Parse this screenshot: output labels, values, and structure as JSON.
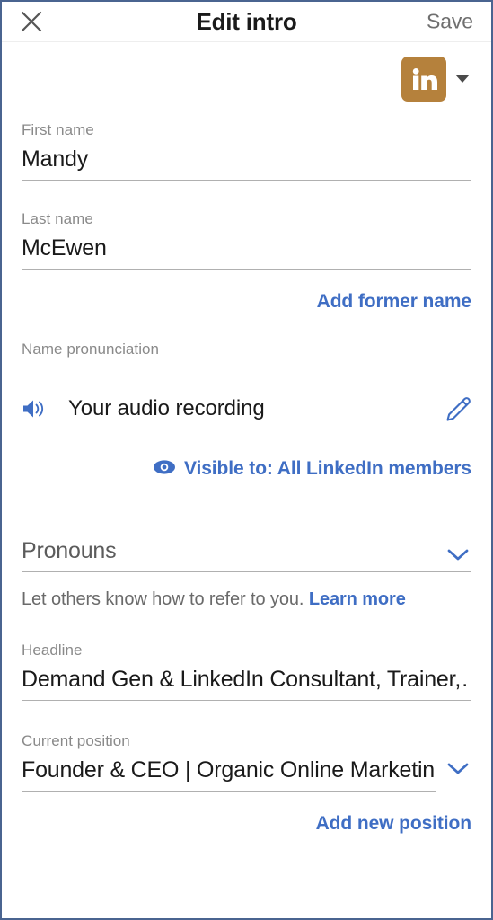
{
  "header": {
    "close_icon": "close-icon",
    "title": "Edit intro",
    "save_label": "Save"
  },
  "branding": {
    "logo_icon": "linkedin-logo-icon",
    "logo_text": "in",
    "logo_color": "#b5813c",
    "dropdown_icon": "caret-down-icon"
  },
  "fields": {
    "first_name": {
      "label": "First name",
      "value": "Mandy",
      "placeholder": "First name"
    },
    "last_name": {
      "label": "Last name",
      "value": "McEwen",
      "placeholder": "Last name"
    },
    "add_former_name": "Add former name",
    "name_pronunciation": {
      "label": "Name pronunciation",
      "audio_icon": "speaker-icon",
      "audio_label": "Your audio recording",
      "edit_icon": "pencil-icon",
      "visibility_icon": "eye-icon",
      "visibility_label": "Visible to: All LinkedIn members"
    },
    "pronouns": {
      "label": "Pronouns",
      "chevron_icon": "chevron-down-icon",
      "helper_text": "Let others know how to refer to you.",
      "helper_link": "Learn more"
    },
    "headline": {
      "label": "Headline",
      "value": "Demand Gen & LinkedIn Consultant, Trainer,…"
    },
    "current_position": {
      "label": "Current position",
      "value": "Founder & CEO | Organic Online Marketing…",
      "chevron_icon": "chevron-down-icon"
    },
    "add_new_position": "Add new position"
  },
  "colors": {
    "link_blue": "#3f6ec4",
    "icon_blue": "#3f6ec4",
    "label_gray": "#8a8a8a",
    "text_dark": "#1a1a1a",
    "save_gray": "#6f6f6f"
  }
}
